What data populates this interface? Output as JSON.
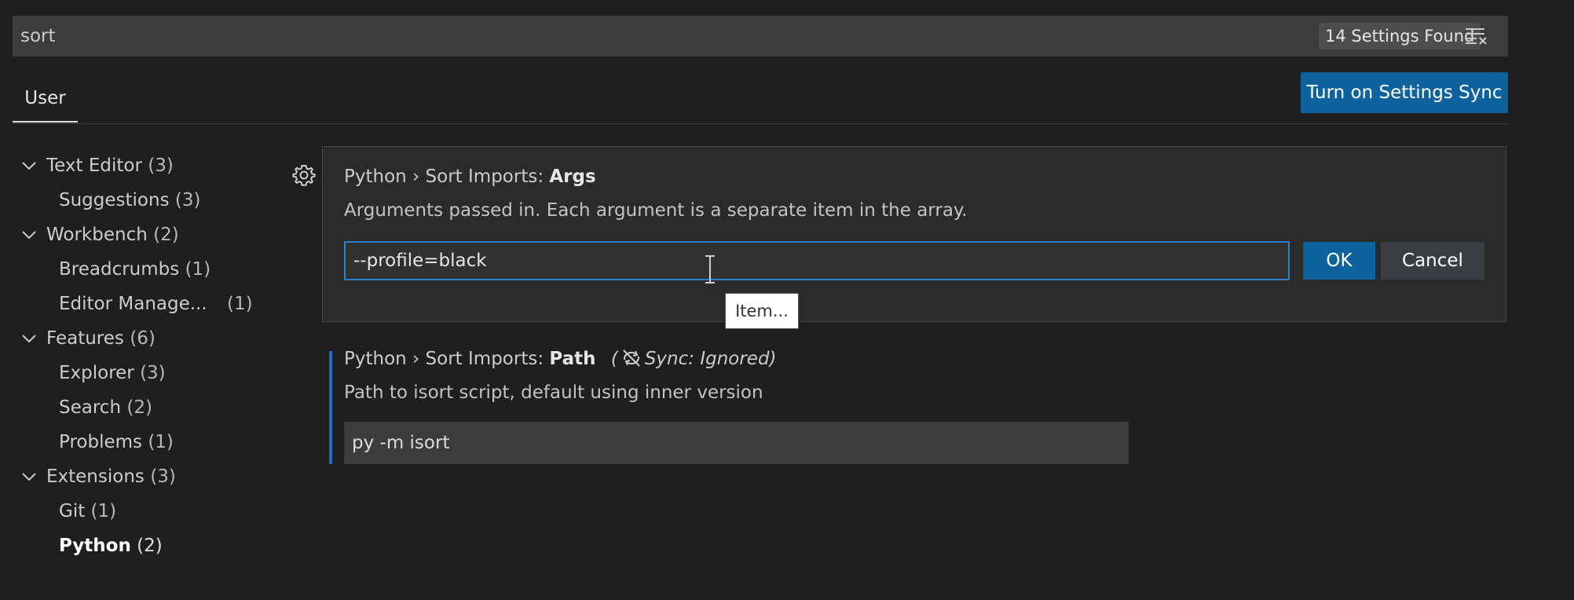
{
  "search": {
    "query": "sort",
    "results_count": "14 Settings Found",
    "clear_icon": "clear-filter-icon"
  },
  "tabs": [
    {
      "label": "User",
      "active": true
    }
  ],
  "sync_button": "Turn on Settings Sync",
  "toc": {
    "items": [
      {
        "label": "Text Editor",
        "count": "(3)",
        "level": 0,
        "expanded": true
      },
      {
        "label": "Suggestions",
        "count": "(3)",
        "level": 1
      },
      {
        "label": "Workbench",
        "count": "(2)",
        "level": 0,
        "expanded": true
      },
      {
        "label": "Breadcrumbs",
        "count": "(1)",
        "level": 1
      },
      {
        "label": "Editor Manage...",
        "count": "(1)",
        "level": 1
      },
      {
        "label": "Features",
        "count": "(6)",
        "level": 0,
        "expanded": true
      },
      {
        "label": "Explorer",
        "count": "(3)",
        "level": 1
      },
      {
        "label": "Search",
        "count": "(2)",
        "level": 1
      },
      {
        "label": "Problems",
        "count": "(1)",
        "level": 1
      },
      {
        "label": "Extensions",
        "count": "(3)",
        "level": 0,
        "expanded": true
      },
      {
        "label": "Git",
        "count": "(1)",
        "level": 1
      },
      {
        "label": "Python",
        "count": "(2)",
        "level": 1,
        "active": true
      }
    ]
  },
  "settings": [
    {
      "category": "Python › Sort Imports: ",
      "name": "Args",
      "description": "Arguments passed in. Each argument is a separate item in the array.",
      "edit_value": "--profile=black",
      "ok_label": "OK",
      "cancel_label": "Cancel",
      "tooltip": "Item..."
    },
    {
      "category": "Python › Sort Imports: ",
      "name": "Path",
      "sync_note": "Sync: Ignored)",
      "sync_open": "(",
      "description": "Path to isort script, default using inner version",
      "value": "py -m isort"
    }
  ],
  "colors": {
    "accent": "#0e639c",
    "focus_border": "#2d80cf",
    "modified_indicator": "#1d6fbd"
  }
}
